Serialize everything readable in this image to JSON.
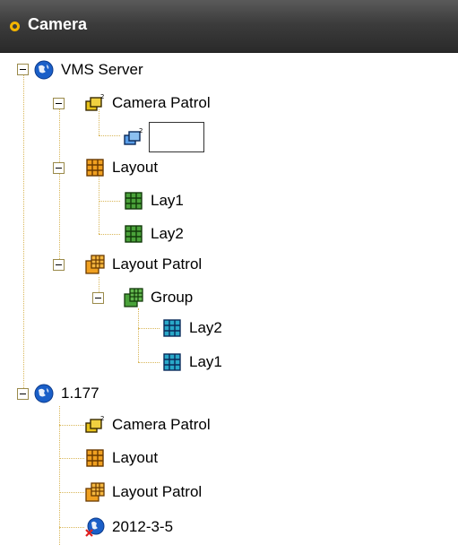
{
  "header": {
    "title": "Camera"
  },
  "tree": {
    "server1": {
      "label": "VMS Server",
      "camera_patrol": {
        "label": "Camera Patrol",
        "rename_value": ""
      },
      "layout": {
        "label": "Layout",
        "children": [
          "Lay1",
          "Lay2"
        ]
      },
      "layout_patrol": {
        "label": "Layout Patrol",
        "group": {
          "label": "Group",
          "children": [
            "Lay2",
            "Lay1"
          ]
        }
      }
    },
    "server2": {
      "label": "1.177",
      "children": [
        "Camera Patrol",
        "Layout",
        "Layout Patrol",
        "2012-3-5"
      ]
    }
  },
  "icons": {
    "server": "globe-icon",
    "camera_patrol": "camera-patrol-icon",
    "layout": "layout-grid-icon",
    "layout_item": "layout-item-icon",
    "layout_patrol": "layout-patrol-icon",
    "offline_server": "globe-offline-icon"
  },
  "colors": {
    "header_accent": "#f2b400",
    "layout_item": "#4aa23a",
    "group_item": "#29a8c8",
    "layout": "#f0a020"
  }
}
